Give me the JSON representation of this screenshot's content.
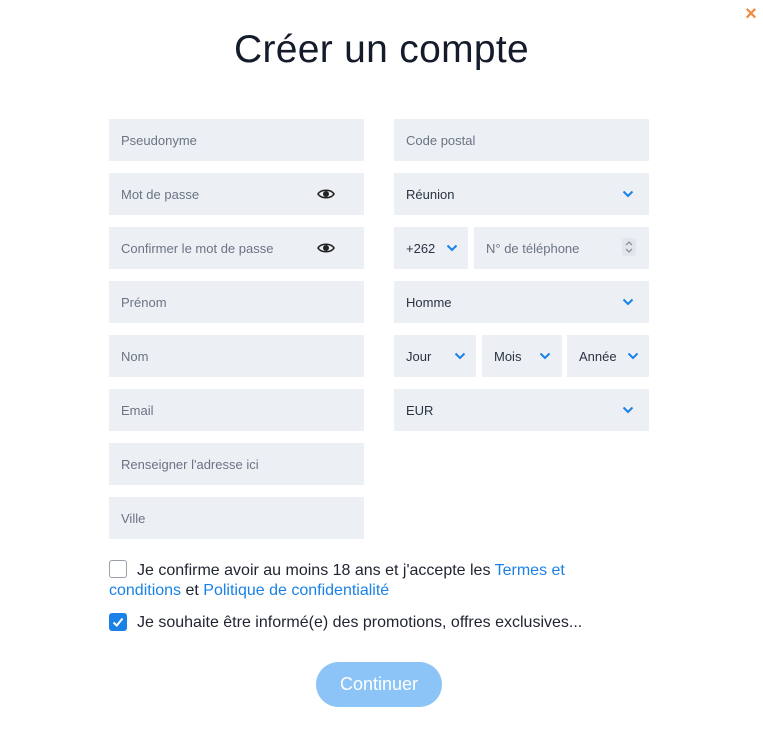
{
  "close_label": "×",
  "title": "Créer un compte",
  "left": {
    "pseudonyme": "Pseudonyme",
    "password": "Mot de passe",
    "confirm_password": "Confirmer le mot de passe",
    "prenom": "Prénom",
    "nom": "Nom",
    "email": "Email",
    "address": "Renseigner l'adresse ici",
    "ville": "Ville"
  },
  "right": {
    "postal_code": "Code postal",
    "region": "Réunion",
    "phone_prefix": "+262",
    "phone_placeholder": "N° de téléphone",
    "gender": "Homme",
    "day": "Jour",
    "month": "Mois",
    "year": "Année",
    "currency": "EUR"
  },
  "consent": {
    "terms_text_1": "Je confirme avoir au moins 18 ans et j'accepte les ",
    "terms_link": "Termes et",
    "terms_link_2": "conditions",
    "and": " et ",
    "privacy_link": "Politique de confidentialité",
    "terms_checked": false,
    "promo_text": "Je souhaite être informé(e) des promotions, offres exclusives...",
    "promo_checked": true
  },
  "continue_label": "Continuer",
  "colors": {
    "accent": "#1a82e6",
    "button": "#8cc4f7",
    "close": "#f28a3c",
    "field_bg": "#eceff4"
  }
}
